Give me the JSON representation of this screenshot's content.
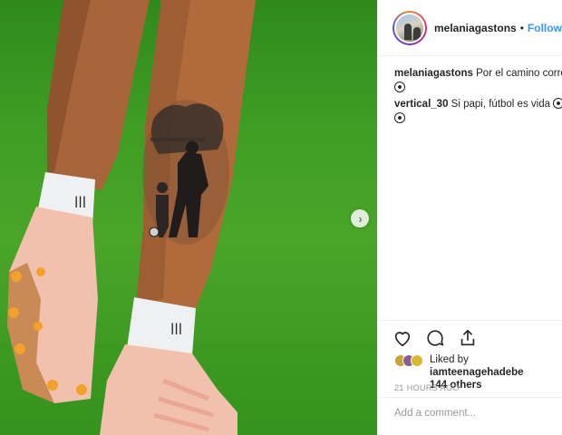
{
  "post": {
    "username": "melaniagastons",
    "separator": "•",
    "follow_label": "Follow"
  },
  "comments": [
    {
      "user": "melaniagastons",
      "text": "Por el camino correc",
      "emoji": "soccer-ball-icon"
    },
    {
      "user": "vertical_30",
      "text": "Si papi, fútbol es vida",
      "emoji": "soccer-ball-icon"
    }
  ],
  "likes": {
    "prefix": "Liked by ",
    "user": "iamteenagehadebe",
    "and": "and",
    "others": "144 others"
  },
  "timestamp": "21 HOURS AGO",
  "add_comment": {
    "placeholder": "Add a comment..."
  },
  "icons": [
    "heart-icon",
    "comment-icon",
    "share-icon",
    "next-arrow-icon"
  ],
  "colors": {
    "follow": "#3897f0",
    "text": "#262626",
    "muted": "#999999",
    "grass": "#3f9e24"
  }
}
